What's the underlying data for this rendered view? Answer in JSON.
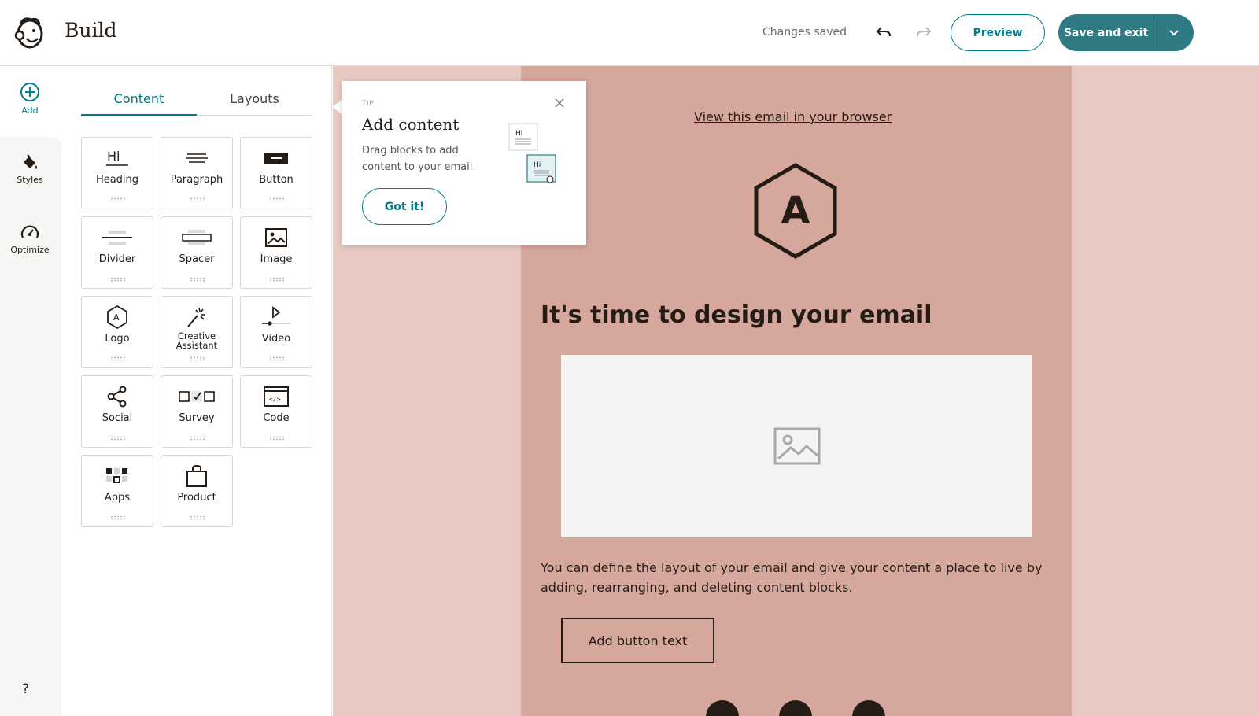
{
  "header": {
    "app_title": "Build",
    "status": "Changes saved",
    "preview_label": "Preview",
    "save_label": "Save and exit"
  },
  "rail": {
    "add": "Add",
    "styles": "Styles",
    "optimize": "Optimize",
    "help": "?"
  },
  "panel": {
    "tabs": [
      {
        "label": "Content",
        "active": true
      },
      {
        "label": "Layouts",
        "active": false
      }
    ],
    "blocks": [
      {
        "label": "Heading",
        "icon": "heading-icon"
      },
      {
        "label": "Paragraph",
        "icon": "paragraph-icon"
      },
      {
        "label": "Button",
        "icon": "button-icon"
      },
      {
        "label": "Divider",
        "icon": "divider-icon"
      },
      {
        "label": "Spacer",
        "icon": "spacer-icon"
      },
      {
        "label": "Image",
        "icon": "image-icon"
      },
      {
        "label": "Logo",
        "icon": "logo-icon"
      },
      {
        "label": "Creative Assistant",
        "icon": "magic-wand-icon"
      },
      {
        "label": "Video",
        "icon": "video-icon"
      },
      {
        "label": "Social",
        "icon": "share-icon"
      },
      {
        "label": "Survey",
        "icon": "survey-icon"
      },
      {
        "label": "Code",
        "icon": "code-icon"
      },
      {
        "label": "Apps",
        "icon": "apps-icon"
      },
      {
        "label": "Product",
        "icon": "shopping-bag-icon"
      }
    ]
  },
  "tip": {
    "label": "TIP",
    "title": "Add content",
    "body": "Drag blocks to add content to your email.",
    "button": "Got it!",
    "illus_text": "Hi"
  },
  "email": {
    "view_link": "View this email in your browser",
    "logo_letter": "A",
    "headline": "It's time to design your email",
    "body": "You can define the layout of your email and give your content a place to live by adding, rearranging, and deleting content blocks.",
    "button_text": "Add button text"
  },
  "colors": {
    "accent": "#007c89",
    "save_button": "#2f7b84",
    "canvas_outer": "#e8cac3",
    "email_bg": "#d6a79d",
    "text": "#241c15"
  }
}
